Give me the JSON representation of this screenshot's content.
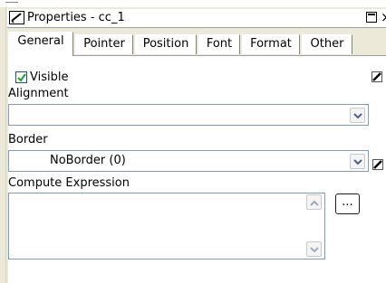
{
  "window": {
    "title": "Properties - cc_1",
    "close_glyph": "×"
  },
  "tabs": [
    {
      "label": "General",
      "active": true
    },
    {
      "label": "Pointer",
      "active": false
    },
    {
      "label": "Position",
      "active": false
    },
    {
      "label": "Font",
      "active": false
    },
    {
      "label": "Format",
      "active": false
    },
    {
      "label": "Other",
      "active": false
    }
  ],
  "general": {
    "visible": {
      "label": "Visible",
      "checked": true
    },
    "alignment": {
      "label": "Alignment",
      "value": ""
    },
    "border": {
      "label": "Border",
      "value": "NoBorder (0)"
    },
    "compute_expression": {
      "label": "Compute Expression",
      "value": "",
      "button_label": "..."
    }
  },
  "colors": {
    "field_border": "#7f9db9",
    "panel_bg": "#ffffff",
    "chrome_bg": "#ECE9D8"
  }
}
